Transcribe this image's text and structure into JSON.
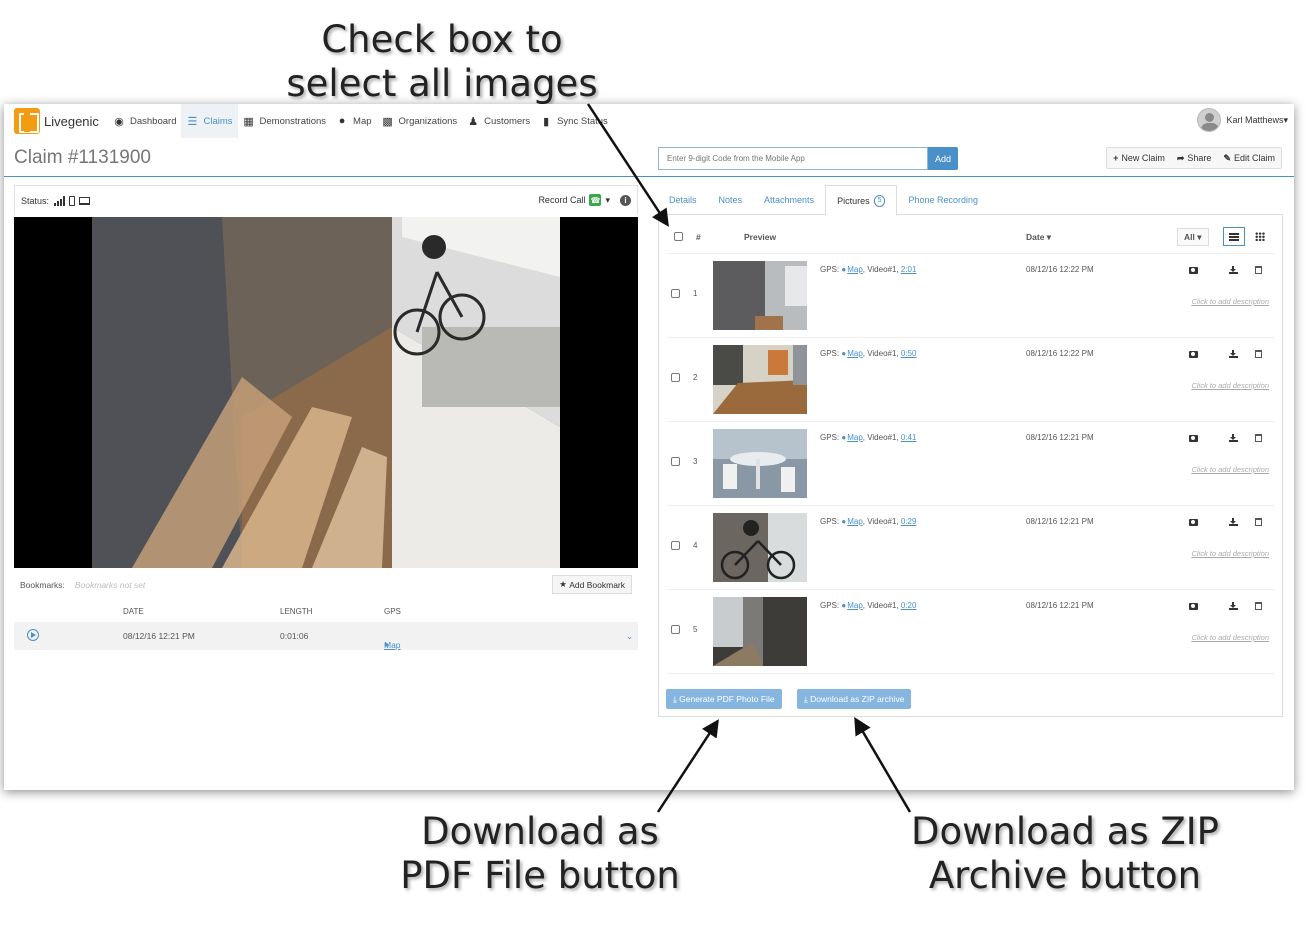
{
  "annotations": {
    "top": [
      "Check box to",
      "select all images"
    ],
    "pdf": [
      "Download as",
      "PDF File button"
    ],
    "zip": [
      "Download as ZIP",
      "Archive button"
    ]
  },
  "nav": {
    "brand": "Livegenic",
    "items": [
      {
        "label": "Dashboard",
        "icon": "dashboard-icon"
      },
      {
        "label": "Claims",
        "icon": "claims-icon",
        "active": true
      },
      {
        "label": "Demonstrations",
        "icon": "film-icon"
      },
      {
        "label": "Map",
        "icon": "globe-icon"
      },
      {
        "label": "Organizations",
        "icon": "building-icon"
      },
      {
        "label": "Customers",
        "icon": "user-icon"
      },
      {
        "label": "Sync Status",
        "icon": "bar-chart-icon"
      }
    ],
    "user_name": "Karl Matthews"
  },
  "claim": {
    "title": "Claim #1131900",
    "code_placeholder": "Enter 9-digit Code from the Mobile App",
    "add_label": "Add",
    "new_claim": "New Claim",
    "share": "Share",
    "edit_claim": "Edit Claim"
  },
  "left": {
    "status_label": "Status:",
    "record_call": "Record Call",
    "bookmarks_label": "Bookmarks:",
    "bookmarks_empty": "Bookmarks not set",
    "add_bookmark": "Add Bookmark",
    "columns": {
      "date": "DATE",
      "length": "LENGTH",
      "gps": "GPS"
    },
    "recording": {
      "date": "08/12/16 12:21 PM",
      "length": "0:01:06",
      "gps": "Map"
    }
  },
  "tabs": {
    "details": "Details",
    "notes": "Notes",
    "attachments": "Attachments",
    "pictures": "Pictures",
    "pictures_count": "5",
    "phone_recording": "Phone Recording"
  },
  "pictures": {
    "header": {
      "num": "#",
      "preview": "Preview",
      "date": "Date",
      "filter": "All"
    },
    "gps_prefix": "GPS:",
    "map_label": "Map",
    "description_placeholder": "Click to add description",
    "rows": [
      {
        "num": "1",
        "video": ", Video#1, ",
        "time": "2:01",
        "date": "08/12/16 12:22 PM"
      },
      {
        "num": "2",
        "video": ", Video#1, ",
        "time": "0:50",
        "date": "08/12/16 12:22 PM"
      },
      {
        "num": "3",
        "video": ", Video#1, ",
        "time": "0:41",
        "date": "08/12/16 12:21 PM"
      },
      {
        "num": "4",
        "video": ", Video#1, ",
        "time": "0:29",
        "date": "08/12/16 12:21 PM"
      },
      {
        "num": "5",
        "video": ", Video#1, ",
        "time": "0:20",
        "date": "08/12/16 12:21 PM"
      }
    ],
    "pdf_button": "Generate PDF Photo File",
    "zip_button": "Download as ZIP archive"
  },
  "colors": {
    "accent": "#4a90c8",
    "brand": "#f39c12",
    "button_light": "#86b6df"
  }
}
